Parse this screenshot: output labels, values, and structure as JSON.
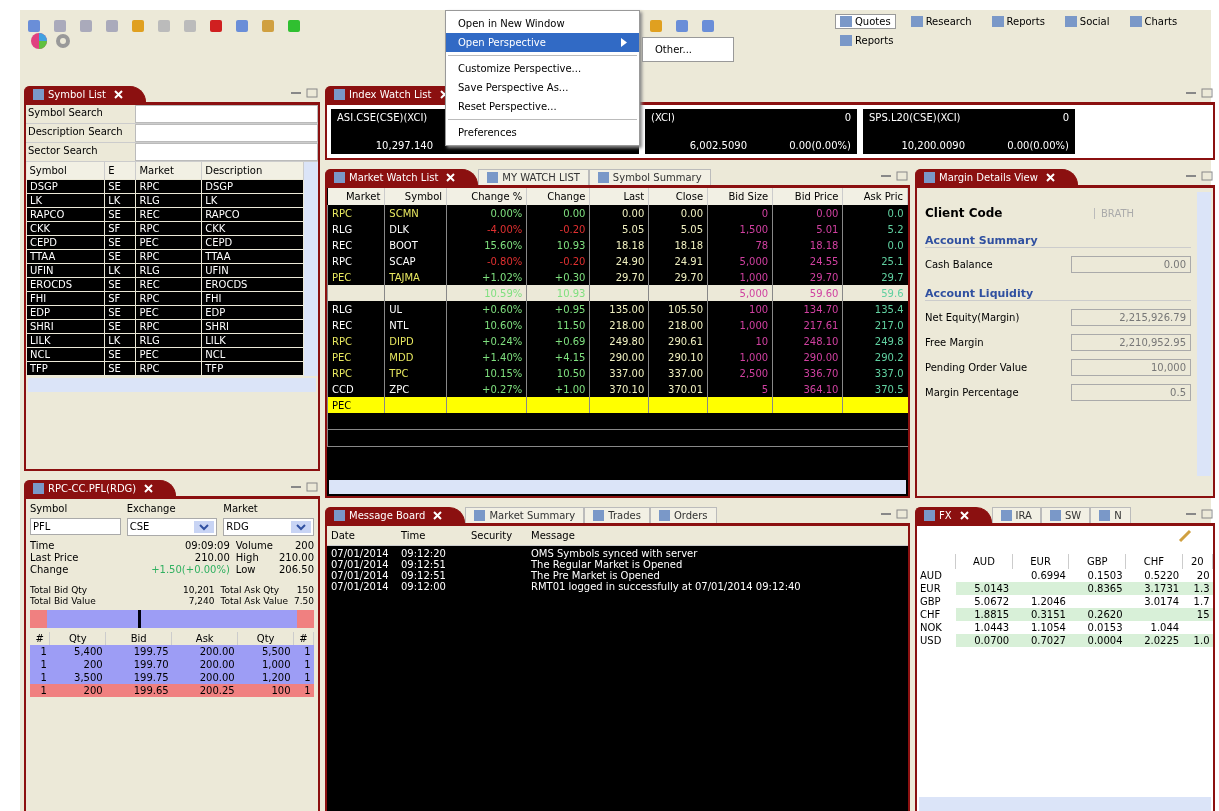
{
  "toolbar": {
    "perspectives": [
      {
        "label": "Quotes",
        "selected": true
      },
      {
        "label": "Research",
        "selected": false
      },
      {
        "label": "Reports",
        "selected": false
      },
      {
        "label": "Social",
        "selected": false
      },
      {
        "label": "Charts",
        "selected": false
      },
      {
        "label": "Reports",
        "selected": false
      }
    ]
  },
  "menu": {
    "items": [
      {
        "kind": "item",
        "label": "Open in New Window",
        "selected": false,
        "submenu": false
      },
      {
        "kind": "item",
        "label": "Open Perspective",
        "selected": true,
        "submenu": true
      },
      {
        "kind": "separator"
      },
      {
        "kind": "item",
        "label": "Customize Perspective...",
        "selected": false,
        "submenu": false
      },
      {
        "kind": "item",
        "label": "Save Perspective As...",
        "selected": false,
        "submenu": false
      },
      {
        "kind": "item",
        "label": "Reset Perspective...",
        "selected": false,
        "submenu": false
      },
      {
        "kind": "separator"
      },
      {
        "kind": "item",
        "label": "Preferences",
        "selected": false,
        "submenu": false
      }
    ],
    "submenu": [
      "Other..."
    ]
  },
  "symbol_list": {
    "tabs": [
      {
        "label": "Symbol List",
        "selected": true
      }
    ],
    "search_fields": [
      {
        "label": "Symbol Search"
      },
      {
        "label": "Description Search"
      },
      {
        "label": "Sector Search"
      }
    ],
    "columns": [
      "Symbol",
      "E",
      "Market",
      "Description"
    ],
    "rows": [
      [
        "DSGP",
        "SE",
        "RPC",
        "DSGP"
      ],
      [
        "LK",
        "LK",
        "RLG",
        "LK"
      ],
      [
        "RAPCO",
        "SE",
        "REC",
        "RAPCO"
      ],
      [
        "CKK",
        "SF",
        "RPC",
        "CKK"
      ],
      [
        "CEPD",
        "SE",
        "PEC",
        "CEPD"
      ],
      [
        "TTAA",
        "SE",
        "RPC",
        "TTAA"
      ],
      [
        "UFIN",
        "LK",
        "RLG",
        "UFIN"
      ],
      [
        "EROCDS",
        "SE",
        "REC",
        "EROCDS"
      ],
      [
        "FHI",
        "SF",
        "RPC",
        "FHI"
      ],
      [
        "EDP",
        "SE",
        "PEC",
        "EDP"
      ],
      [
        "SHRI",
        "SE",
        "RPC",
        "SHRI"
      ],
      [
        "LILK",
        "LK",
        "RLG",
        "LILK"
      ],
      [
        "NCL",
        "SE",
        "PEC",
        "NCL"
      ],
      [
        "TFP",
        "SE",
        "RPC",
        "TFP"
      ]
    ]
  },
  "index_watch": {
    "tabs": [
      {
        "label": "Index Watch List",
        "selected": true
      }
    ],
    "tiles": [
      {
        "name": "ASI.CSE(CSE)(XCI)",
        "value": "10,297.140"
      },
      {
        "name": "(XCI)",
        "trend": "0",
        "value": "6,002.5090",
        "change": "0.00(0.00%)"
      },
      {
        "name": "SPS.L20(CSE)(XCI)",
        "trend": "0",
        "value": "10,200.0090",
        "change": "0.00(0.00%)"
      }
    ]
  },
  "market_watch": {
    "tabs": [
      {
        "label": "Market Watch List",
        "selected": true
      },
      {
        "label": "MY WATCH LIST",
        "selected": false
      },
      {
        "label": "Symbol Summary",
        "selected": false
      }
    ],
    "columns": [
      "Market",
      "Symbol",
      "Change %",
      "Change",
      "Last",
      "Close",
      "Bid Size",
      "Bid Price",
      "Ask Pric"
    ],
    "rows": [
      {
        "kind": "normal",
        "marked": true,
        "falling": false,
        "cells": [
          "RPC",
          "SCMN",
          "0.00%",
          "0.00",
          "0.00",
          "0.00",
          "0",
          "0.00",
          "0.0"
        ]
      },
      {
        "kind": "normal",
        "marked": false,
        "falling": true,
        "cells": [
          "RLG",
          "DLK",
          "-4.00%",
          "-0.20",
          "5.05",
          "5.05",
          "1,500",
          "5.01",
          "5.2"
        ]
      },
      {
        "kind": "normal",
        "marked": false,
        "falling": false,
        "cells": [
          "REC",
          "BOOT",
          "15.60%",
          "10.93",
          "18.18",
          "18.18",
          "78",
          "18.18",
          "0.0"
        ]
      },
      {
        "kind": "normal",
        "marked": false,
        "falling": true,
        "cells": [
          "RPC",
          "SCAP",
          "-0.80%",
          "-0.20",
          "24.90",
          "24.91",
          "5,000",
          "24.55",
          "25.1"
        ]
      },
      {
        "kind": "normal",
        "marked": true,
        "falling": false,
        "cells": [
          "PEC",
          "TAJMA",
          "+1.02%",
          "+0.30",
          "29.70",
          "29.70",
          "1,000",
          "29.70",
          "29.7"
        ]
      },
      {
        "kind": "highlight",
        "falling": false,
        "cells": [
          "",
          "",
          "10.59%",
          "10.93",
          "",
          "",
          "5,000",
          "59.60",
          "59.6"
        ]
      },
      {
        "kind": "normal",
        "marked": false,
        "falling": false,
        "cells": [
          "RLG",
          "UL",
          "+0.60%",
          "+0.95",
          "135.00",
          "105.50",
          "100",
          "134.70",
          "135.4"
        ]
      },
      {
        "kind": "normal",
        "marked": false,
        "falling": false,
        "cells": [
          "REC",
          "NTL",
          "10.60%",
          "11.50",
          "218.00",
          "218.00",
          "1,000",
          "217.61",
          "217.0"
        ]
      },
      {
        "kind": "normal",
        "marked": true,
        "falling": false,
        "cells": [
          "RPC",
          "DIPD",
          "+0.24%",
          "+0.69",
          "249.80",
          "290.61",
          "10",
          "248.10",
          "249.8"
        ]
      },
      {
        "kind": "normal",
        "marked": true,
        "falling": false,
        "cells": [
          "PEC",
          "MDD",
          "+1.40%",
          "+4.15",
          "290.00",
          "290.10",
          "1,000",
          "290.00",
          "290.2"
        ]
      },
      {
        "kind": "normal",
        "marked": true,
        "falling": false,
        "cells": [
          "RPC",
          "TPC",
          "10.15%",
          "10.50",
          "337.00",
          "337.00",
          "2,500",
          "336.70",
          "337.0"
        ]
      },
      {
        "kind": "normal",
        "marked": false,
        "falling": false,
        "cells": [
          "CCD",
          "ZPC",
          "+0.27%",
          "+1.00",
          "370.10",
          "370.01",
          "5",
          "364.10",
          "370.5"
        ]
      },
      {
        "kind": "selected",
        "cells": [
          "PEC",
          "",
          "",
          "",
          "",
          "",
          "",
          "",
          ""
        ]
      }
    ]
  },
  "margin": {
    "tabs": [
      {
        "label": "Margin Details View",
        "selected": true
      }
    ],
    "client_code": {
      "label": "Client Code",
      "value": "BRATH"
    },
    "sections": [
      {
        "title": "Account Summary",
        "fields": [
          {
            "label": "Cash Balance",
            "value": "0.00"
          }
        ]
      },
      {
        "title": "Account Liquidity",
        "fields": [
          {
            "label": "Net Equity(Margin)",
            "value": "2,215,926.79"
          },
          {
            "label": "Free Margin",
            "value": "2,210,952.95"
          },
          {
            "label": "Pending Order Value",
            "value": "10,000"
          },
          {
            "label": "Margin Percentage",
            "value": "0.5"
          }
        ]
      }
    ]
  },
  "quote": {
    "tabs": [
      {
        "label": "RPC-CC.PFL(RDG)",
        "selected": true
      }
    ],
    "selectors": [
      {
        "label": "Symbol",
        "value": "PFL",
        "dropdown": false
      },
      {
        "label": "Exchange",
        "value": "CSE",
        "dropdown": true
      },
      {
        "label": "Market",
        "value": "RDG",
        "dropdown": true
      }
    ],
    "stats": [
      {
        "label": "Time",
        "value": "09:09:09",
        "label2": "Volume",
        "value2": "200"
      },
      {
        "label": "Last Price",
        "value": "210.00",
        "label2": "High",
        "value2": "210.00"
      },
      {
        "label": "Change",
        "value": "+1.50(+0.00%)",
        "label2": "Low",
        "value2": "206.50",
        "kind": "change"
      }
    ],
    "totals": [
      {
        "label": "Total Bid Qty",
        "value": "10,201",
        "label2": "Total Ask Qty",
        "value2": "150"
      },
      {
        "label": "Total Bid Value",
        "value": "7,240",
        "label2": "Total Ask Value",
        "value2": "7.50"
      }
    ],
    "depth_bar": {
      "level": 0.38
    },
    "depth_columns": [
      "#",
      "Qty",
      "Bid",
      "Ask",
      "Qty",
      "#"
    ],
    "depth_rows": [
      {
        "kind": "bid",
        "cells": [
          "1",
          "5,400",
          "199.75",
          "200.00",
          "5,500",
          "1"
        ]
      },
      {
        "kind": "bid",
        "cells": [
          "1",
          "200",
          "199.70",
          "200.00",
          "1,000",
          "1"
        ]
      },
      {
        "kind": "bid",
        "cells": [
          "1",
          "3,500",
          "199.75",
          "200.00",
          "1,200",
          "1"
        ]
      },
      {
        "kind": "ask",
        "cells": [
          "1",
          "200",
          "199.65",
          "200.25",
          "100",
          "1"
        ]
      }
    ]
  },
  "messages": {
    "tabs": [
      {
        "label": "Message Board",
        "selected": true
      },
      {
        "label": "Market Summary",
        "selected": false
      },
      {
        "label": "Trades",
        "selected": false
      },
      {
        "label": "Orders",
        "selected": false
      }
    ],
    "columns": [
      "Date",
      "Time",
      "Security",
      "Message"
    ],
    "rows": [
      [
        "07/01/2014",
        "09:12:20",
        "",
        "OMS Symbols synced with server"
      ],
      [
        "07/01/2014",
        "09:12:51",
        "",
        "The Regular Market is Opened"
      ],
      [
        "07/01/2014",
        "09:12:51",
        "",
        "The Pre Market is Opened"
      ],
      [
        "07/01/2014",
        "09:12:00",
        "",
        "RMT01 logged in successfully at 07/01/2014 09:12:40"
      ]
    ]
  },
  "fx": {
    "tabs": [
      {
        "label": "FX",
        "selected": true
      },
      {
        "label": "IRA",
        "selected": false
      },
      {
        "label": "SW",
        "selected": false
      },
      {
        "label": "N",
        "selected": false
      }
    ],
    "columns": [
      "AUD",
      "EUR",
      "GBP",
      "CHF",
      "20"
    ],
    "rows": [
      {
        "label": "AUD",
        "cells": [
          "",
          "0.6994",
          "0.1503",
          "0.5220",
          "20"
        ]
      },
      {
        "label": "EUR",
        "cells": [
          "5.0143",
          "",
          "0.8365",
          "3.1731",
          "1.3"
        ]
      },
      {
        "label": "GBP",
        "cells": [
          "5.0672",
          "1.2046",
          "",
          "3.0174",
          "1.7"
        ]
      },
      {
        "label": "CHF",
        "cells": [
          "1.8815",
          "0.3151",
          "0.2620",
          "",
          "15"
        ]
      },
      {
        "label": "NOK",
        "cells": [
          "1.0443",
          "1.1054",
          "0.0153",
          "1.044",
          ""
        ]
      },
      {
        "label": "USD",
        "cells": [
          "0.0700",
          "0.7027",
          "0.0004",
          "2.0225",
          "1.0"
        ]
      }
    ]
  }
}
